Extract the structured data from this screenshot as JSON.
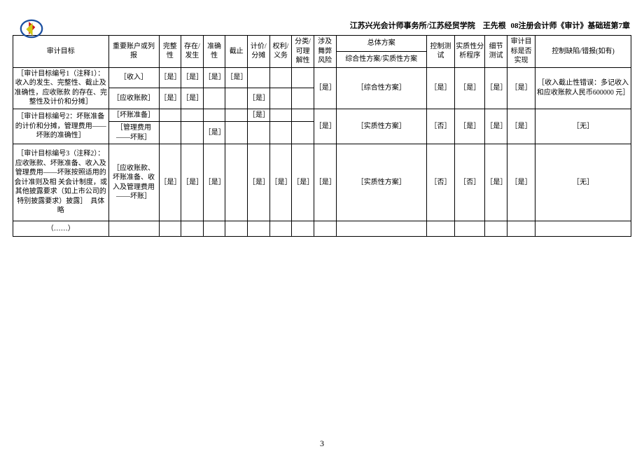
{
  "header": "江苏兴光会计师事务所/江苏经贸学院　王先根 08注册会计师《审计》基础班第7章",
  "head": {
    "objective": "审计目标",
    "account": "重要账户或列报",
    "completeness": "完整性",
    "existence": "存在/发生",
    "accuracy": "准确性",
    "cutoff": "截止",
    "valuation": "计价/分摊",
    "rights": "权利/义务",
    "classification": "分类/可理解性",
    "fraud": "涉及舞弊风险",
    "overall_plan": "总体方案",
    "plan_desc": "综合性方案/实质性方案",
    "ctrl_test": "控制测试",
    "substantive": "实质性分析程序",
    "detail": "细节测试",
    "achieved": "审计目标是否实现",
    "defect": "控制缺陷/错报(如有)"
  },
  "rows": [
    {
      "obj": "［审计目标编号1（注释1）：收入的发生、完整性、截止及准确性，应收账款 的存在、完整性及计价和分摊］",
      "accs": [
        {
          "name": "［收入］",
          "c": "［是］",
          "e": "［是］",
          "a": "［是］",
          "cut": "［是］",
          "v": "",
          "r": "",
          "cl": ""
        },
        {
          "name": "［应收账款］",
          "c": "［是］",
          "e": "［是］",
          "a": "",
          "cut": "",
          "v": "［是］",
          "r": "",
          "cl": ""
        }
      ],
      "fraud": "［是］",
      "plan": "［综合性方案］",
      "ctrl": "［是］",
      "sub": "［是］",
      "det": "［是］",
      "ach": "［是］",
      "def": "［收入截止性错误：多记收入和应收账款人民币600000 元］"
    },
    {
      "obj": "［审计目标编号2：坏账准备的计价和分摊，管理费用——坏账的准确性］",
      "accs": [
        {
          "name": "［坏账准备］",
          "c": "",
          "e": "",
          "a": "",
          "cut": "",
          "v": "［是］",
          "r": "",
          "cl": ""
        },
        {
          "name": "［管理费用——坏账］",
          "c": "",
          "e": "",
          "a": "［是］",
          "cut": "",
          "v": "",
          "r": "",
          "cl": ""
        }
      ],
      "fraud": "［是］",
      "plan": "［实质性方案］",
      "ctrl": "［否］",
      "sub": "［是］",
      "det": "［是］",
      "ach": "［是］",
      "def": "［无］"
    },
    {
      "obj": "［审计目标编号3（注释2）：应收账款、坏账准备、收入及管理费用——坏账按照适用的会计准则及相 关会计制度，或其他披露要求（如上市公司的特别披露要求）披露］　具体略",
      "accs": [
        {
          "name": "［应收账款、坏账准备、收入及管理费用——坏账］",
          "c": "［是］",
          "e": "［是］",
          "a": "［是］",
          "cut": "",
          "v": "［是］",
          "r": "［是］",
          "cl": "［是］"
        }
      ],
      "fraud": "［是］",
      "plan": "［实质性方案］",
      "ctrl": "［否］",
      "sub": "［否］",
      "det": "［是］",
      "ach": "［是］",
      "def": "［无］"
    }
  ],
  "dots": "（……）",
  "page": "3"
}
